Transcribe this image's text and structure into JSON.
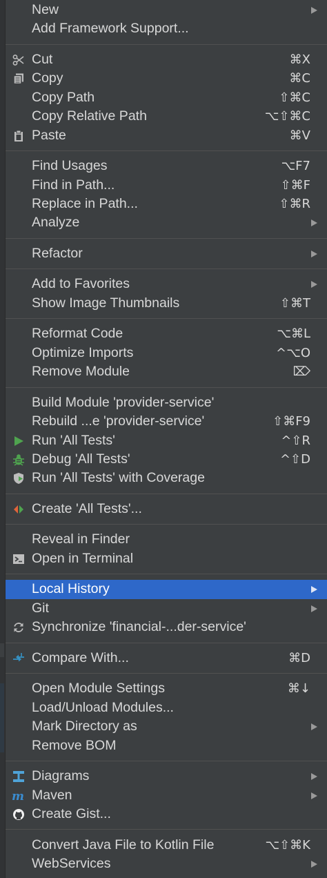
{
  "groups": [
    [
      {
        "label": "New",
        "shortcut": "",
        "submenu": true
      },
      {
        "label": "Add Framework Support...",
        "shortcut": "",
        "submenu": false
      }
    ],
    [
      {
        "label": "Cut",
        "shortcut": "⌘X",
        "icon": "scissors-icon"
      },
      {
        "label": "Copy",
        "shortcut": "⌘C",
        "icon": "copy-icon"
      },
      {
        "label": "Copy Path",
        "shortcut": "⇧⌘C"
      },
      {
        "label": "Copy Relative Path",
        "shortcut": "⌥⇧⌘C"
      },
      {
        "label": "Paste",
        "shortcut": "⌘V",
        "icon": "clipboard-icon"
      }
    ],
    [
      {
        "label": "Find Usages",
        "shortcut": "⌥F7"
      },
      {
        "label": "Find in Path...",
        "shortcut": "⇧⌘F"
      },
      {
        "label": "Replace in Path...",
        "shortcut": "⇧⌘R"
      },
      {
        "label": "Analyze",
        "shortcut": "",
        "submenu": true
      }
    ],
    [
      {
        "label": "Refactor",
        "shortcut": "",
        "submenu": true
      }
    ],
    [
      {
        "label": "Add to Favorites",
        "shortcut": "",
        "submenu": true
      },
      {
        "label": "Show Image Thumbnails",
        "shortcut": "⇧⌘T"
      }
    ],
    [
      {
        "label": "Reformat Code",
        "shortcut": "⌥⌘L"
      },
      {
        "label": "Optimize Imports",
        "shortcut": "^⌥O"
      },
      {
        "label": "Remove Module",
        "shortcut": "⌦"
      }
    ],
    [
      {
        "label": "Build Module 'provider-service'",
        "shortcut": ""
      },
      {
        "label": "Rebuild ...e 'provider-service'",
        "shortcut": "⇧⌘F9"
      },
      {
        "label": "Run 'All Tests'",
        "shortcut": "^⇧R",
        "icon": "run-icon"
      },
      {
        "label": "Debug 'All Tests'",
        "shortcut": "^⇧D",
        "icon": "debug-bug-icon"
      },
      {
        "label": "Run 'All Tests' with Coverage",
        "shortcut": "",
        "icon": "coverage-shield-icon"
      }
    ],
    [
      {
        "label": "Create 'All Tests'...",
        "shortcut": "",
        "icon": "create-test-icon"
      }
    ],
    [
      {
        "label": "Reveal in Finder",
        "shortcut": ""
      },
      {
        "label": "Open in Terminal",
        "shortcut": "",
        "icon": "terminal-icon"
      }
    ],
    [
      {
        "label": "Local History",
        "shortcut": "",
        "submenu": true,
        "selected": true
      },
      {
        "label": "Git",
        "shortcut": "",
        "submenu": true
      },
      {
        "label": "Synchronize 'financial-...der-service'",
        "shortcut": "",
        "icon": "sync-icon"
      }
    ],
    [
      {
        "label": "Compare With...",
        "shortcut": "⌘D",
        "icon": "compare-icon"
      }
    ],
    [
      {
        "label": "Open Module Settings",
        "shortcut": "⌘↓"
      },
      {
        "label": "Load/Unload Modules...",
        "shortcut": ""
      },
      {
        "label": "Mark Directory as",
        "shortcut": "",
        "submenu": true
      },
      {
        "label": "Remove BOM",
        "shortcut": ""
      }
    ],
    [
      {
        "label": "Diagrams",
        "shortcut": "",
        "submenu": true,
        "icon": "diagrams-icon"
      },
      {
        "label": "Maven",
        "shortcut": "",
        "submenu": true,
        "icon": "maven-icon"
      },
      {
        "label": "Create Gist...",
        "shortcut": "",
        "icon": "github-icon"
      }
    ],
    [
      {
        "label": "Convert Java File to Kotlin File",
        "shortcut": "⌥⇧⌘K"
      },
      {
        "label": "WebServices",
        "shortcut": "",
        "submenu": true
      }
    ]
  ],
  "colors": {
    "menu_bg": "#3c3f41",
    "selected_bg": "#2e68c9",
    "text": "#d8d8d8",
    "run_green": "#4fa34f"
  }
}
